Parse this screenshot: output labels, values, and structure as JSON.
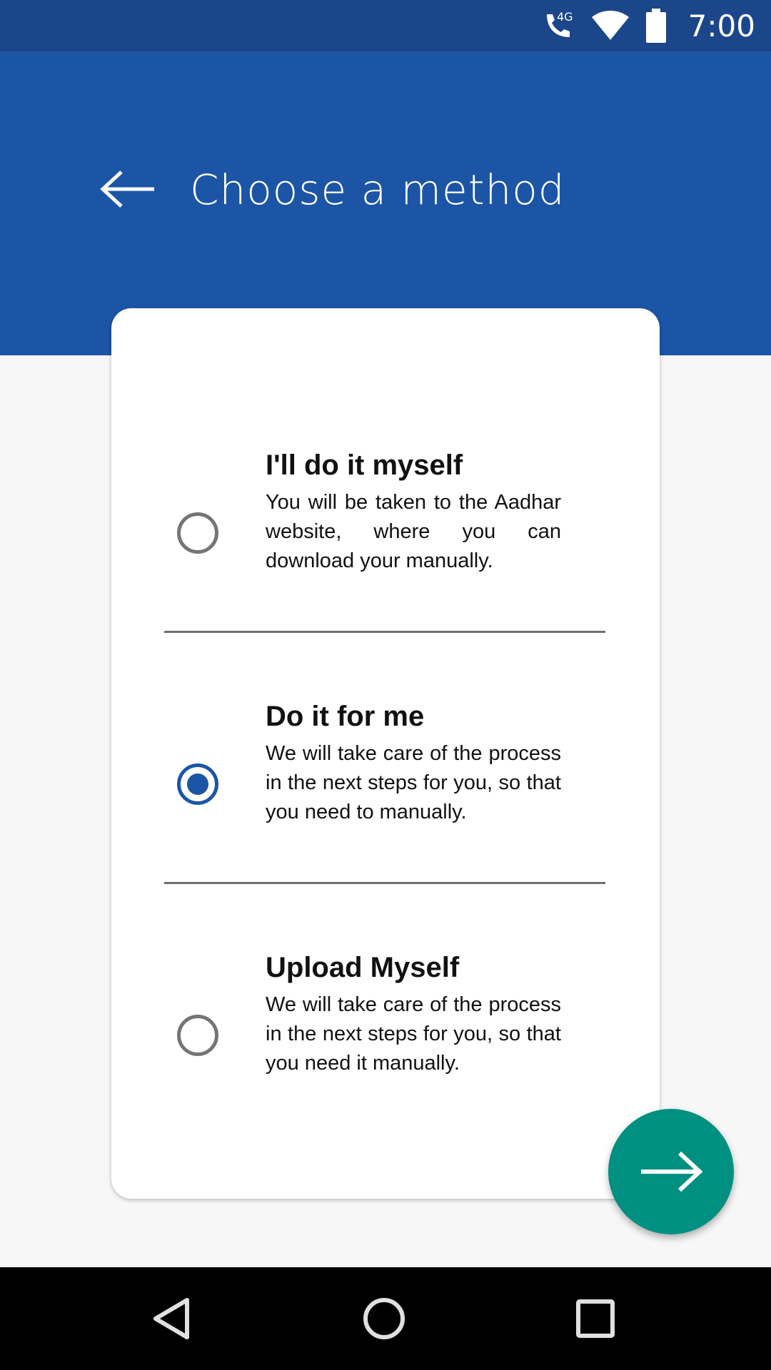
{
  "status_bar": {
    "time": "7:00",
    "network": "4G",
    "icons": [
      "call-4g-icon",
      "wifi-icon",
      "battery-icon"
    ]
  },
  "header": {
    "title": "Choose a method",
    "back_icon": "arrow-left-icon"
  },
  "options": [
    {
      "title": "I'll do it myself",
      "description": "You will be taken to the Aadhar website, where you can download your manually.",
      "selected": false
    },
    {
      "title": "Do it for me",
      "description": "We will take care of the process in the next steps for you, so that you need to manually.",
      "selected": true
    },
    {
      "title": "Upload Myself",
      "description": "We will take care of the process in the next steps for you, so that you need it manually.",
      "selected": false
    }
  ],
  "fab": {
    "icon": "arrow-right-icon"
  },
  "nav_bar": {
    "icons": [
      "back-triangle-icon",
      "home-circle-icon",
      "recents-square-icon"
    ]
  },
  "colors": {
    "status_bar": "#1b4689",
    "primary": "#1c55a6",
    "accent": "#009082",
    "background": "#f7f7f7"
  }
}
